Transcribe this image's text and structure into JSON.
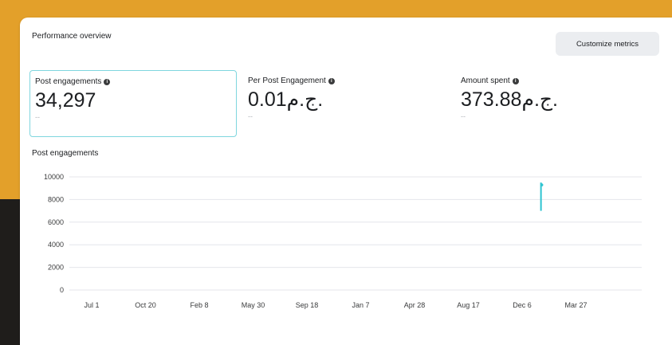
{
  "panel": {
    "title": "Performance overview",
    "customize_label": "Customize metrics"
  },
  "metrics": [
    {
      "label": "Post engagements",
      "value": "34,297",
      "sub": "--",
      "selected": true
    },
    {
      "label": "Per Post Engagement",
      "value": "0.01ج.م.",
      "sub": "--",
      "selected": false
    },
    {
      "label": "Amount spent",
      "value": "373.88ج.م.",
      "sub": "--",
      "selected": false
    }
  ],
  "colors": {
    "accent": "#2ec4d0",
    "selected_border": "#7fd6de",
    "background_top": "#e3a02a",
    "background_bottom": "#1f1d1b"
  },
  "chart_data": {
    "type": "line",
    "title": "Post engagements",
    "xlabel": "",
    "ylabel": "",
    "yticks": [
      10000,
      8000,
      6000,
      4000,
      2000,
      0
    ],
    "ylim": [
      0,
      10000
    ],
    "xticks": [
      "Jul 1",
      "Oct 20",
      "Feb 8",
      "May 30",
      "Sep 18",
      "Jan 7",
      "Apr 28",
      "Aug 17",
      "Dec 6",
      "Mar 27"
    ],
    "grid": true,
    "series": [
      {
        "values_at_tick": "Dec 6",
        "low": 7000,
        "high": 9500,
        "note_index": 8.35
      }
    ]
  }
}
